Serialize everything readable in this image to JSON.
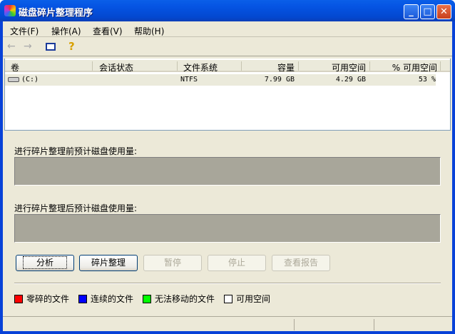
{
  "window": {
    "title": "磁盘碎片整理程序"
  },
  "menu": [
    "文件(F)",
    "操作(A)",
    "查看(V)",
    "帮助(H)"
  ],
  "columns": [
    "卷",
    "会话状态",
    "文件系统",
    "容量",
    "可用空间",
    "% 可用空间"
  ],
  "volumes": [
    {
      "name": "(C:)",
      "status": "",
      "fs": "NTFS",
      "capacity": "7.99 GB",
      "free": "4.29 GB",
      "pct_free": "53 %"
    }
  ],
  "before_label": "进行碎片整理前预计磁盘使用量:",
  "after_label": "进行碎片整理后预计磁盘使用量:",
  "buttons": {
    "analyze": "分析",
    "defrag": "碎片整理",
    "pause": "暂停",
    "stop": "停止",
    "report": "查看报告"
  },
  "legend": [
    {
      "label": "零碎的文件",
      "color": "#ff0000"
    },
    {
      "label": "连续的文件",
      "color": "#0000ff"
    },
    {
      "label": "无法移动的文件",
      "color": "#00ff00"
    },
    {
      "label": "可用空间",
      "color": "#ffffff"
    }
  ]
}
